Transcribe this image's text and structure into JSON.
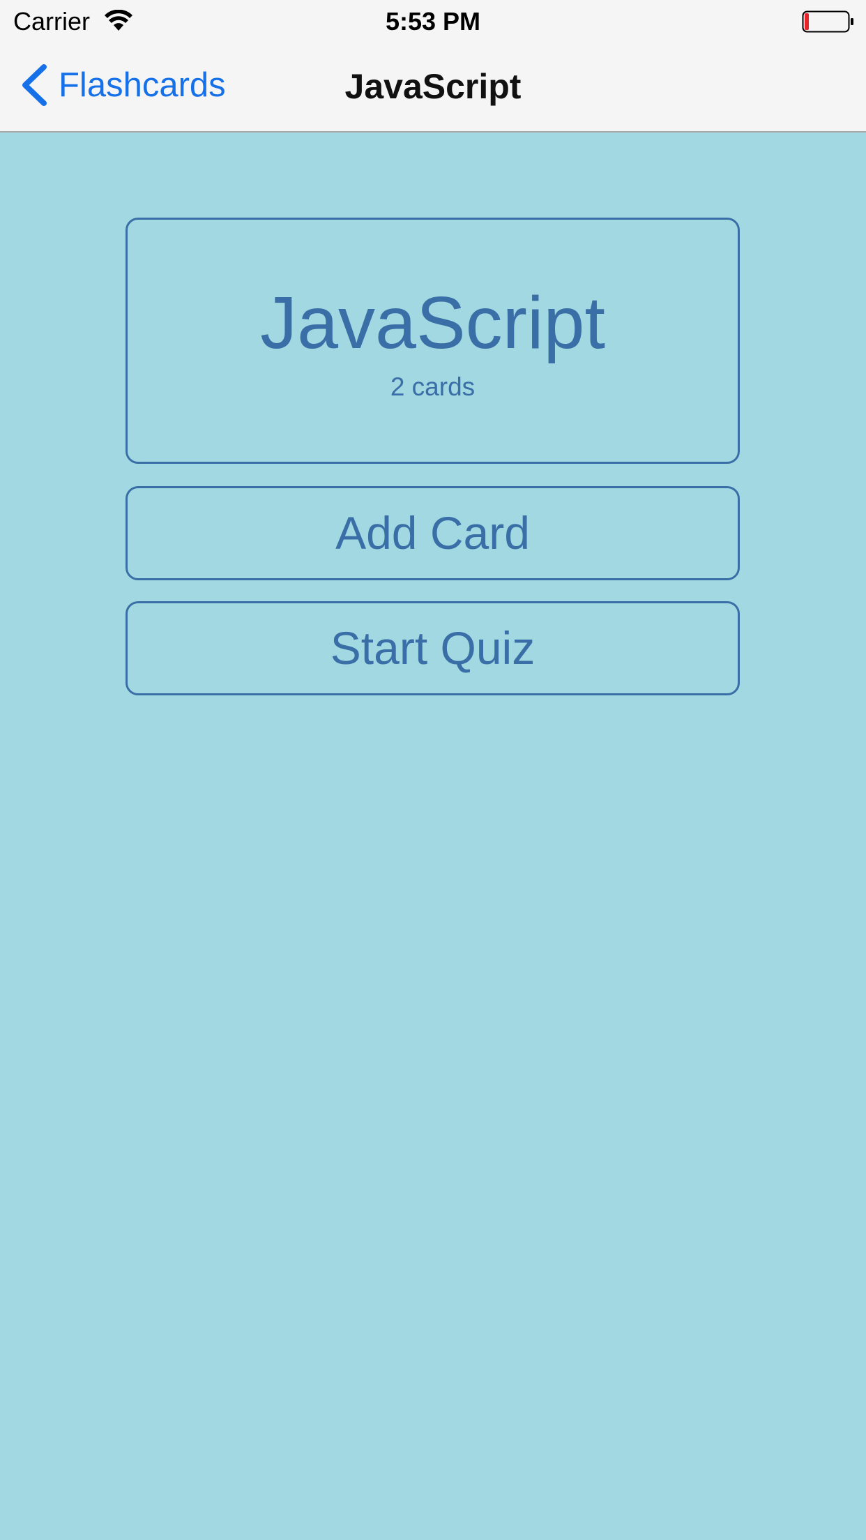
{
  "status_bar": {
    "carrier": "Carrier",
    "time": "5:53 PM",
    "wifi_icon": "wifi-icon",
    "battery_icon": "battery-icon",
    "battery_color": "#e8242b"
  },
  "nav_bar": {
    "back_label": "Flashcards",
    "back_icon": "chevron-left-icon",
    "title": "JavaScript",
    "accent_color": "#1670e8"
  },
  "deck": {
    "title": "JavaScript",
    "card_count": "2 cards"
  },
  "actions": {
    "add_card_label": "Add Card",
    "start_quiz_label": "Start Quiz"
  },
  "colors": {
    "background": "#a2d8e1",
    "primary": "#3a6ea7",
    "nav_background": "#f5f5f5"
  }
}
